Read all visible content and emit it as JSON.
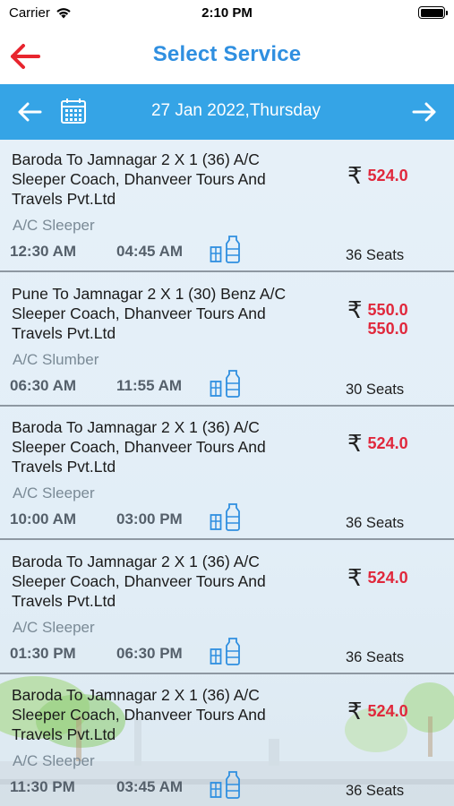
{
  "status_bar": {
    "carrier": "Carrier",
    "time": "2:10 PM"
  },
  "nav": {
    "title": "Select Service",
    "back_icon": "back-arrow-icon"
  },
  "date_bar": {
    "date": "27 Jan 2022,Thursday"
  },
  "colors": {
    "accent": "#35a4e6",
    "title": "#2f8fe0",
    "fare": "#e0283c",
    "back": "#e8252e"
  },
  "services": [
    {
      "name": "Baroda To Jamnagar 2 X 1 (36) A/C Sleeper Coach, Dhanveer Tours And Travels Pvt.Ltd",
      "fares": [
        "524.0"
      ],
      "type": "A/C Sleeper",
      "departure": "12:30 AM",
      "arrival": "04:45 AM",
      "seats": "36 Seats"
    },
    {
      "name": "Pune To Jamnagar 2 X 1 (30) Benz A/C Sleeper Coach, Dhanveer Tours And Travels Pvt.Ltd",
      "fares": [
        "550.0",
        "550.0"
      ],
      "type": "A/C Slumber",
      "departure": "06:30 AM",
      "arrival": "11:55 AM",
      "seats": "30 Seats"
    },
    {
      "name": "Baroda To Jamnagar 2 X 1 (36) A/C Sleeper Coach, Dhanveer Tours And Travels Pvt.Ltd",
      "fares": [
        "524.0"
      ],
      "type": "A/C Sleeper",
      "departure": "10:00 AM",
      "arrival": "03:00 PM",
      "seats": "36 Seats"
    },
    {
      "name": "Baroda To Jamnagar 2 X 1 (36) A/C Sleeper Coach, Dhanveer Tours And Travels Pvt.Ltd",
      "fares": [
        "524.0"
      ],
      "type": "A/C Sleeper",
      "departure": "01:30 PM",
      "arrival": "06:30 PM",
      "seats": "36 Seats"
    },
    {
      "name": "Baroda To Jamnagar 2 X 1 (36) A/C Sleeper Coach, Dhanveer Tours And Travels Pvt.Ltd",
      "fares": [
        "524.0"
      ],
      "type": "A/C Sleeper",
      "departure": "11:30 PM",
      "arrival": "03:45 AM",
      "seats": "36 Seats"
    }
  ]
}
